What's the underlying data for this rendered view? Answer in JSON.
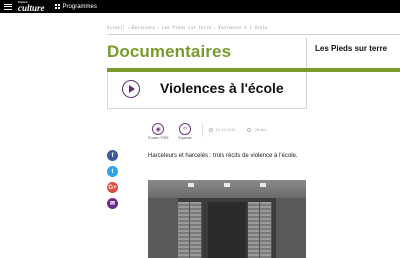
{
  "header": {
    "menu_icon": "hamburger-icon",
    "logo_small": "france",
    "logo_big": "culture",
    "programmes_label": "Programmes"
  },
  "breadcrumb": {
    "items": [
      "Accueil",
      "Émissions",
      "Les Pieds sur terre",
      "Violences à l'école"
    ],
    "separator": "›"
  },
  "section": {
    "title": "Documentaires",
    "show_name": "Les Pieds sur terre",
    "accent_color": "#7a9a2e"
  },
  "episode": {
    "title": "Violences à l'école",
    "play_icon": "play-icon"
  },
  "meta": {
    "podcast_label": "iTunes / RSS",
    "embed_label": "Exporter",
    "date": "21.11.2016",
    "duration": "28 min"
  },
  "share": {
    "facebook": "f",
    "twitter": "t",
    "google": "G+",
    "email": "✉"
  },
  "summary": "Harceleurs et harcelés : trois récits de violence à l'école."
}
